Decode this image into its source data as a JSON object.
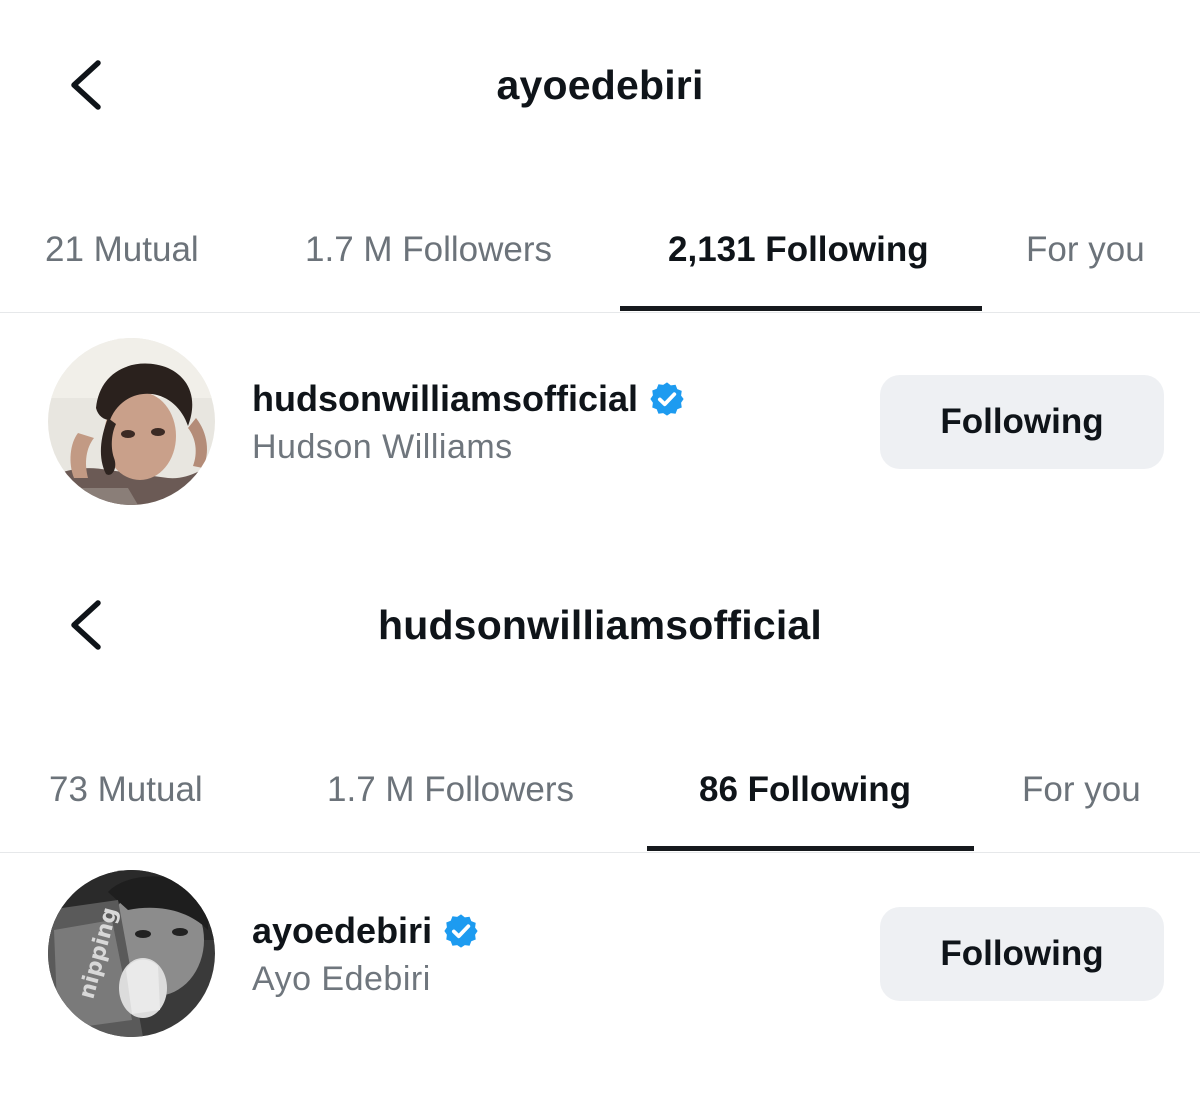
{
  "colors": {
    "verified": "#1d9bf0",
    "active_indicator": "#16191d",
    "button_bg": "#eef0f3",
    "inactive_tab_text": "#6c737a"
  },
  "panels": [
    {
      "title": "ayoedebiri",
      "back_icon": "chevron-left-icon",
      "tabs": [
        {
          "label": "21 Mutual",
          "active": false
        },
        {
          "label": "1.7 M Followers",
          "active": false
        },
        {
          "label": "2,131 Following",
          "active": true
        },
        {
          "label": "For you",
          "active": false
        }
      ],
      "row": {
        "username": "hudsonwilliamsofficial",
        "verified_icon": "verified-badge-icon",
        "full_name": "Hudson Williams",
        "button_label": "Following"
      }
    },
    {
      "title": "hudsonwilliamsofficial",
      "back_icon": "chevron-left-icon",
      "tabs": [
        {
          "label": "73 Mutual",
          "active": false
        },
        {
          "label": "1.7 M Followers",
          "active": false
        },
        {
          "label": "86 Following",
          "active": true
        },
        {
          "label": "For you",
          "active": false
        }
      ],
      "row": {
        "username": "ayoedebiri",
        "verified_icon": "verified-badge-icon",
        "full_name": "Ayo Edebiri",
        "button_label": "Following"
      }
    }
  ]
}
